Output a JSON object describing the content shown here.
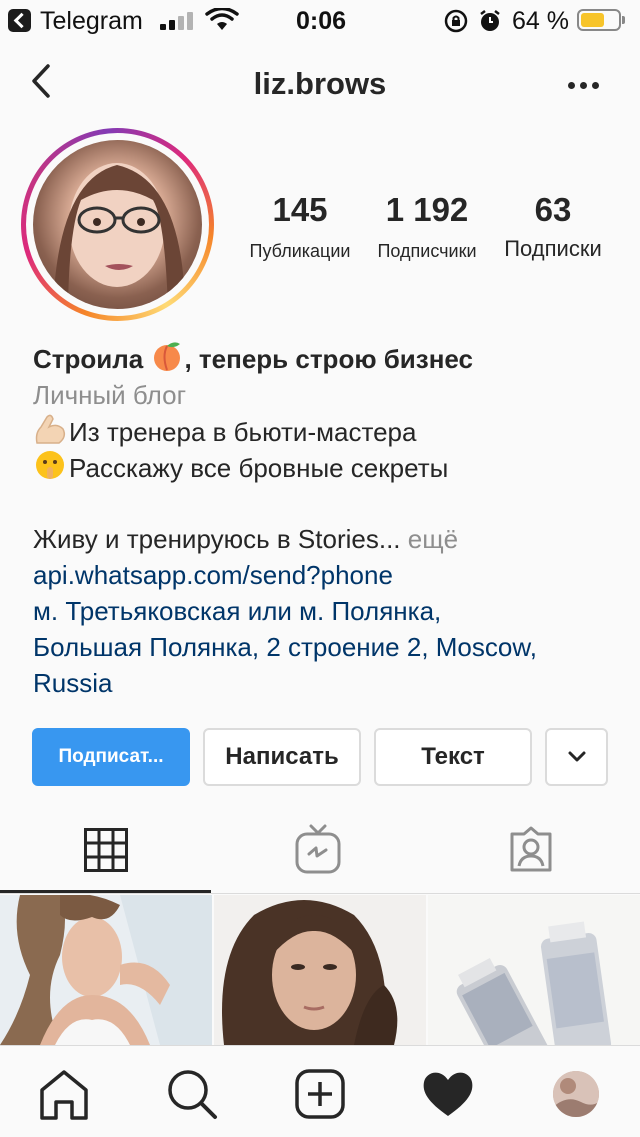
{
  "status_bar": {
    "back_app": "Telegram",
    "time": "0:06",
    "battery_percent_text": "64 %",
    "battery_level": 0.64,
    "battery_color": "#f7c42a"
  },
  "nav": {
    "title": "liz.brows",
    "back_icon": "chevron-left-icon",
    "more_icon": "more-horizontal-icon"
  },
  "profile": {
    "avatar": "profile-photo",
    "ring_colors": [
      "#f58529",
      "#dd2a7b",
      "#833ab4",
      "#feda75"
    ],
    "stats": [
      {
        "value": "145",
        "label": "Публикации"
      },
      {
        "value": "1 192",
        "label": "Подписчики"
      },
      {
        "value": "63",
        "label": "Подписки"
      }
    ]
  },
  "bio": {
    "name": "Строила",
    "name_rest": ", теперь строю бизнес",
    "category": "Личный блог",
    "line1": "Из тренера в бьюти-мастера",
    "line2": "Расскажу все бровные секреты",
    "line3": "Живу и тренируюсь в Stories...",
    "more": "ещё",
    "link": "api.whatsapp.com/send?phone",
    "address_line1": "м. Третьяковская или м. Полянка,",
    "address_line2": "Большая Полянка, 2 строение 2, Moscow,",
    "address_line3": "Russia"
  },
  "actions": {
    "follow": "Подписат...",
    "message": "Написать",
    "text": "Текст",
    "dropdown_icon": "chevron-down-icon"
  },
  "tabs": [
    {
      "icon": "grid-icon",
      "active": true
    },
    {
      "icon": "igtv-icon",
      "active": false
    },
    {
      "icon": "tagged-icon",
      "active": false
    }
  ],
  "grid": [
    {
      "desc": "photo-woman-white-top"
    },
    {
      "desc": "photo-woman-curly-hair"
    },
    {
      "desc": "photo-cosmetic-tubes"
    }
  ],
  "bottom_nav": [
    {
      "icon": "home-icon"
    },
    {
      "icon": "search-icon"
    },
    {
      "icon": "add-post-icon"
    },
    {
      "icon": "heart-icon"
    },
    {
      "icon": "profile-avatar"
    }
  ],
  "colors": {
    "accent": "#3897f0",
    "link": "#003569",
    "muted": "#8e8e8e"
  }
}
